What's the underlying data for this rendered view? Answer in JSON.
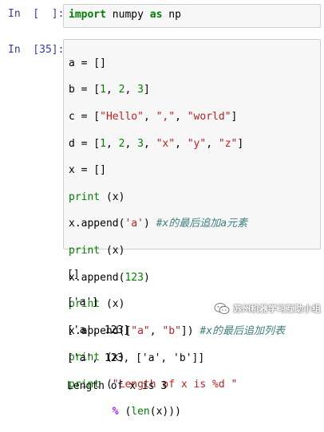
{
  "cells": [
    {
      "prompt": "In  [  ]:",
      "code_parts": {
        "kw1": "import",
        "t1": " numpy ",
        "kw2": "as",
        "t2": " np"
      }
    },
    {
      "prompt": "In  [35]:",
      "lines": [
        {
          "a1": "a = []"
        },
        {
          "a1": "b = [",
          "n1": "1",
          "a2": ", ",
          "n2": "2",
          "a3": ", ",
          "n3": "3",
          "a4": "]"
        },
        {
          "a1": "c = [",
          "s1": "\"Hello\"",
          "a2": ", ",
          "s2": "\",\"",
          "a3": ", ",
          "s3": "\"world\"",
          "a4": "]"
        },
        {
          "a1": "d = [",
          "n1": "1",
          "a2": ", ",
          "n2": "2",
          "a3": ", ",
          "n3": "3",
          "a4": ", ",
          "s1": "\"x\"",
          "a5": ", ",
          "s2": "\"y\"",
          "a6": ", ",
          "s3": "\"z\"",
          "a7": "]"
        },
        {
          "a1": "x = []"
        },
        {
          "b1": "print",
          "a1": " (x)"
        },
        {
          "a1": "x.append(",
          "s1": "'a'",
          "a2": ") ",
          "c1": "#x的最后追加a元素"
        },
        {
          "b1": "print",
          "a1": " (x)"
        },
        {
          "a1": "x.append(",
          "n1": "123",
          "a2": ")"
        },
        {
          "b1": "print",
          "a1": " (x)"
        },
        {
          "a1": "x.append([",
          "s1": "\"a\"",
          "a2": ", ",
          "s2": "\"b\"",
          "a3": "]) ",
          "c1": "#x的最后追加列表"
        },
        {
          "b1": "print",
          "a1": " (x)"
        },
        {
          "b1": "print",
          "a1": " (",
          "s1": "\"Length of x is %d \""
        },
        {
          "sp": "       ",
          "o1": "%",
          "a1": " (",
          "b1": "len",
          "a2": "(x)))"
        }
      ],
      "output": [
        "[]",
        "['a']",
        "['a', 123]",
        "['a', 123, ['a', 'b']]",
        "Length of x is 3"
      ]
    }
  ],
  "watermark": {
    "text": "苏州机器学习互助小组",
    "icon": "wechat-icon"
  }
}
